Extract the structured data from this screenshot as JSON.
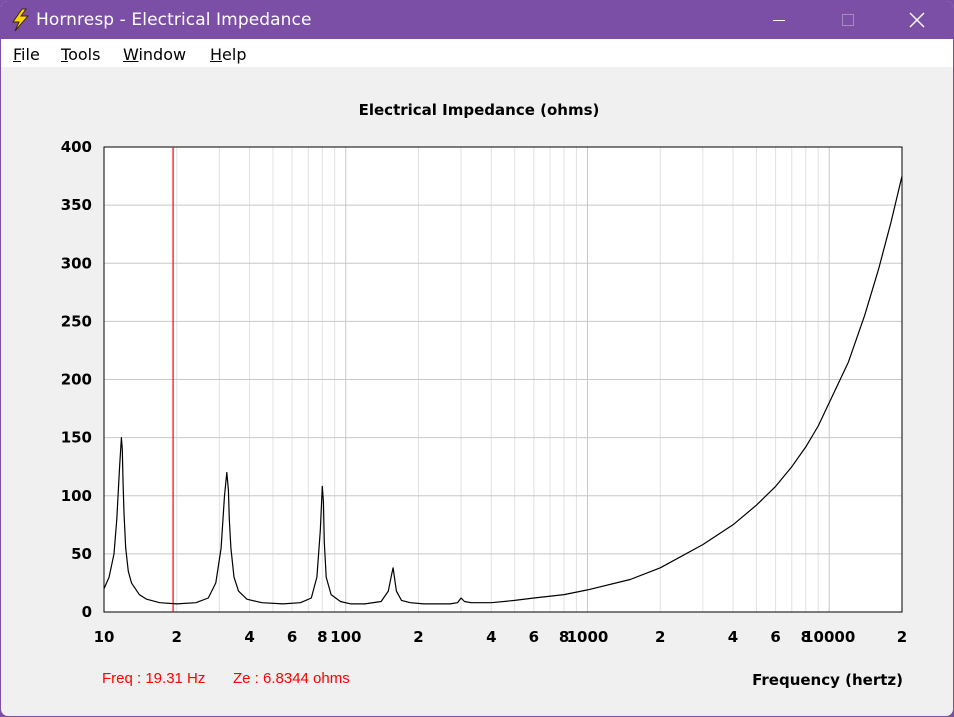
{
  "window": {
    "title": "Hornresp - Electrical Impedance"
  },
  "menu": {
    "items": [
      "File",
      "Tools",
      "Window",
      "Help"
    ]
  },
  "readout": {
    "freq": "Freq : 19.31 Hz",
    "ze": "Ze : 6.8344 ohms"
  },
  "colors": {
    "titlebar": "#7b4fa6",
    "curve": "#000000",
    "cursor": "#ff0000",
    "grid": "#c8c8c8",
    "grid_minor": "#e2e2e2"
  },
  "chart_data": {
    "type": "line",
    "title": "Electrical Impedance (ohms)",
    "xlabel": "Frequency (hertz)",
    "ylabel": "",
    "x_scale": "log",
    "xlim": [
      10,
      20000
    ],
    "ylim": [
      0,
      400
    ],
    "y_ticks": [
      0,
      50,
      100,
      150,
      200,
      250,
      300,
      350,
      400
    ],
    "x_tick_labels": [
      {
        "value": 10,
        "label": "10"
      },
      {
        "value": 20,
        "label": "2"
      },
      {
        "value": 40,
        "label": "4"
      },
      {
        "value": 60,
        "label": "6"
      },
      {
        "value": 80,
        "label": "8"
      },
      {
        "value": 100,
        "label": "100"
      },
      {
        "value": 200,
        "label": "2"
      },
      {
        "value": 400,
        "label": "4"
      },
      {
        "value": 600,
        "label": "6"
      },
      {
        "value": 800,
        "label": "8"
      },
      {
        "value": 1000,
        "label": "1000"
      },
      {
        "value": 2000,
        "label": "2"
      },
      {
        "value": 4000,
        "label": "4"
      },
      {
        "value": 6000,
        "label": "6"
      },
      {
        "value": 8000,
        "label": "8"
      },
      {
        "value": 10000,
        "label": "10000"
      },
      {
        "value": 20000,
        "label": "2"
      }
    ],
    "grid": true,
    "cursor_x": 19.31,
    "series": [
      {
        "x": [
          10,
          10.5,
          11,
          11.3,
          11.6,
          11.8,
          11.9,
          12.0,
          12.1,
          12.3,
          12.6,
          13,
          14,
          15,
          17,
          20,
          24,
          27,
          29,
          30.5,
          31.5,
          32.2,
          32.7,
          33.0,
          33.5,
          34.5,
          36,
          39,
          45,
          55,
          65,
          72,
          76,
          78.5,
          80,
          80.8,
          81.5,
          83,
          87,
          95,
          105,
          120,
          140,
          150,
          155,
          157,
          159,
          162,
          170,
          185,
          210,
          240,
          270,
          290,
          300,
          310,
          330,
          400,
          500,
          600,
          800,
          1000,
          1500,
          2000,
          3000,
          4000,
          5000,
          6000,
          7000,
          8000,
          9000,
          10000,
          12000,
          14000,
          16000,
          18000,
          20000
        ],
        "y": [
          20,
          30,
          50,
          80,
          125,
          150,
          140,
          110,
          85,
          55,
          35,
          25,
          15,
          11,
          8,
          7,
          8,
          12,
          25,
          55,
          100,
          120,
          105,
          80,
          55,
          30,
          18,
          11,
          8,
          7,
          8,
          12,
          30,
          70,
          108,
          95,
          60,
          30,
          15,
          9,
          7,
          7,
          9,
          18,
          33,
          38,
          30,
          18,
          10,
          8,
          7,
          7,
          7,
          8,
          12,
          9,
          8,
          8,
          10,
          12,
          15,
          19,
          28,
          38,
          58,
          75,
          92,
          108,
          125,
          142,
          160,
          180,
          215,
          255,
          295,
          335,
          375
        ]
      }
    ]
  }
}
